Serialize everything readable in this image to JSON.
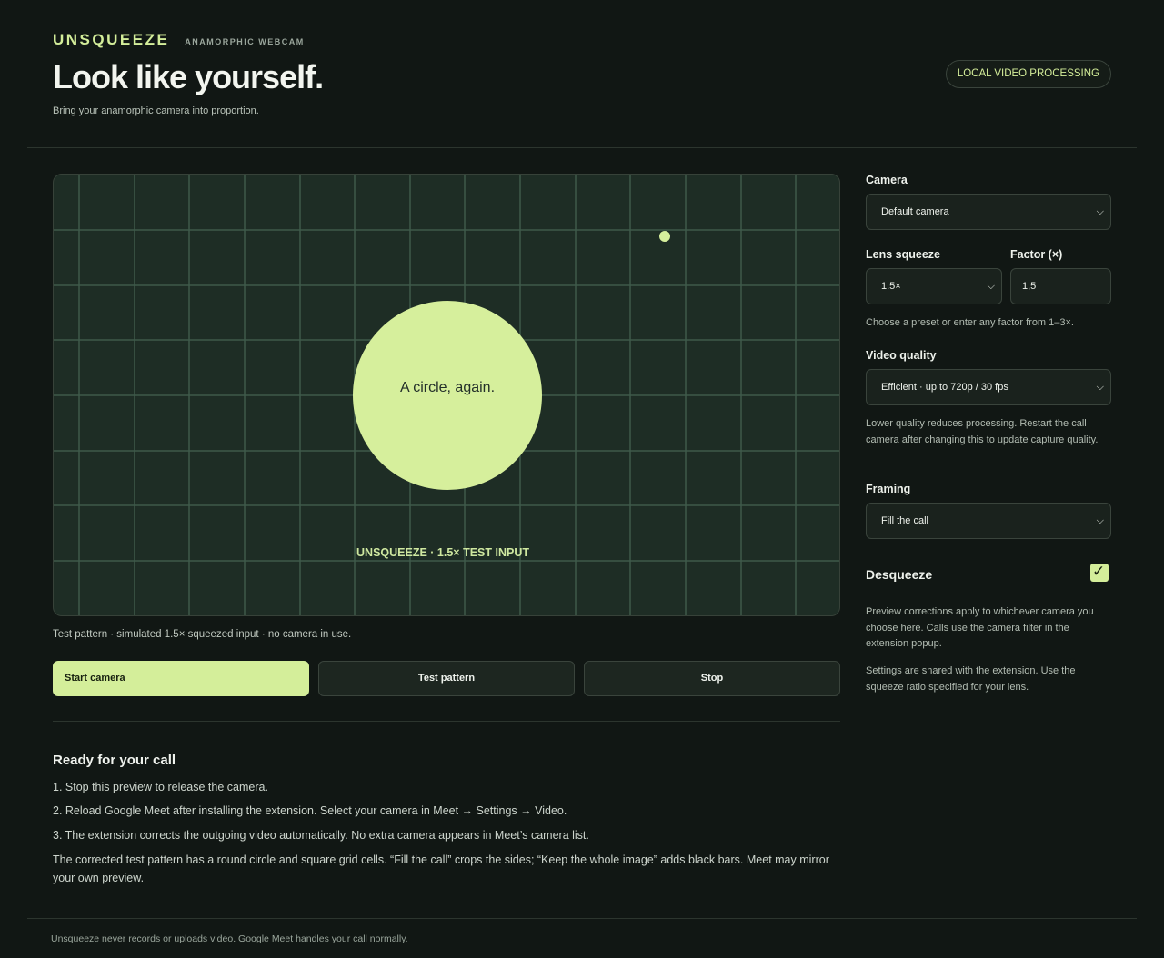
{
  "header": {
    "brand": "UNSQUEEZE",
    "tagline": "ANAMORPHIC WEBCAM",
    "title": "Look like yourself.",
    "subtitle": "Bring your anamorphic camera into proportion.",
    "badge": "LOCAL VIDEO PROCESSING"
  },
  "preview": {
    "circle_label": "A circle, again.",
    "overlay_label": "UNSQUEEZE  ·  1.5× TEST INPUT",
    "caption": "Test pattern · simulated 1.5× squeezed input · no camera in use."
  },
  "controls": {
    "start": "Start camera",
    "test": "Test pattern",
    "stop": "Stop"
  },
  "ready": {
    "title": "Ready for your call",
    "steps": [
      "1. Stop this preview to release the camera.",
      "2. Reload Google Meet after installing the extension. Select your camera in Meet → Settings → Video.",
      "3. The extension corrects the outgoing video automatically. No extra camera appears in Meet’s camera list."
    ],
    "note": "The corrected test pattern has a round circle and square grid cells. “Fill the call” crops the sides; “Keep the whole image” adds black bars. Meet may mirror your own preview."
  },
  "footer": "Unsqueeze never records or uploads video. Google Meet handles your call normally.",
  "settings": {
    "camera_label": "Camera",
    "camera_value": "Default camera",
    "lens_label": "Lens squeeze",
    "lens_value": "1.5×",
    "factor_label": "Factor (×)",
    "factor_value": "1,5",
    "lens_help": "Choose a preset or enter any factor from 1–3×.",
    "quality_label": "Video quality",
    "quality_value": "Efficient · up to 720p / 30 fps",
    "quality_help": "Lower quality reduces processing. Restart the call camera after changing this to update capture quality.",
    "framing_label": "Framing",
    "framing_value": "Fill the call",
    "desqueeze_label": "Desqueeze",
    "desqueeze_checked": true,
    "preview_help": "Preview corrections apply to whichever camera you choose here. Calls use the camera filter in the extension popup.",
    "shared_help": "Settings are shared with the extension. Use the squeeze ratio specified for your lens."
  },
  "colors": {
    "accent": "#d4ee9a",
    "background": "#111714",
    "preview_bg": "#1e2d25"
  }
}
